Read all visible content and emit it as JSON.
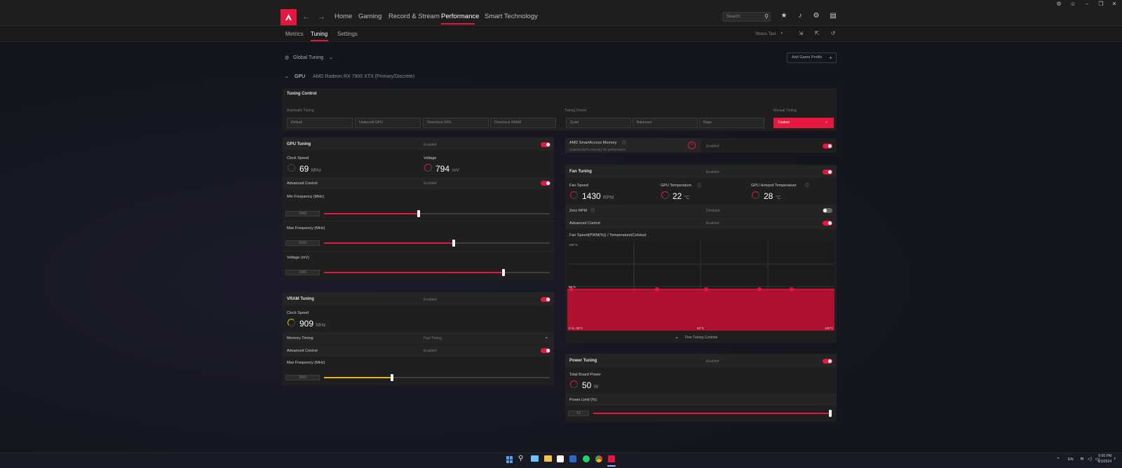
{
  "window": {
    "controls": [
      "⚙",
      "☺",
      "–",
      "❐",
      "✕"
    ]
  },
  "nav": {
    "items": [
      "Home",
      "Gaming",
      "Record & Stream",
      "Performance",
      "Smart Technology"
    ],
    "search_placeholder": "Search"
  },
  "subnav": {
    "items": [
      "Metrics",
      "Tuning",
      "Settings"
    ],
    "stress_test": "Stress Test"
  },
  "profile": {
    "label": "Global Tuning",
    "add_game_profile": "Add Game Profile"
  },
  "gpu": {
    "label": "GPU",
    "name": "AMD Radeon RX 7900 XTX (Primary/Discrete)"
  },
  "tuning_control": {
    "title": "Tuning Control",
    "automatic_label": "Automatic Tuning",
    "automatic": [
      "Default",
      "Undervolt GPU",
      "Overclock GPU",
      "Overclock VRAM"
    ],
    "preset_label": "Tuning Preset",
    "presets": [
      "Quiet",
      "Balanced",
      "Rage"
    ],
    "manual_label": "Manual Tuning",
    "manual": "Custom"
  },
  "gpu_tuning": {
    "title": "GPU Tuning",
    "status": "Enabled",
    "clock_label": "Clock Speed",
    "clock_value": "69",
    "clock_unit": "MHz",
    "voltage_label": "Voltage",
    "voltage_value": "794",
    "voltage_unit": "mV",
    "adv_label": "Advanced Control",
    "adv_status": "Enabled",
    "min_freq_label": "Min Frequency (MHz)",
    "min_freq_value": "2400",
    "min_freq_fill": 0.42,
    "max_freq_label": "Max Frequency (MHz)",
    "max_freq_value": "3100",
    "max_freq_fill": 0.575,
    "volt_label": "Voltage (mV)",
    "volt_value": "1060",
    "volt_fill": 0.795
  },
  "vram_tuning": {
    "title": "VRAM Tuning",
    "status": "Enabled",
    "clock_label": "Clock Speed",
    "clock_value": "909",
    "clock_unit": "MHz",
    "mem_timing_label": "Memory Timing",
    "mem_timing_value": "Fast Timing",
    "adv_label": "Advanced Control",
    "adv_status": "Enabled",
    "max_freq_label": "Max Frequency (MHz)",
    "max_freq_value": "2600",
    "max_freq_fill": 0.3
  },
  "sam": {
    "title": "AMD SmartAccess Memory",
    "desc": "Unlocks dGPU memory for performance",
    "status": "Enabled"
  },
  "fan_tuning": {
    "title": "Fan Tuning",
    "status": "Enabled",
    "fan_speed_label": "Fan Speed",
    "fan_speed_value": "1430",
    "fan_speed_unit": "RPM",
    "gpu_temp_label": "GPU Temperature",
    "gpu_temp_value": "22",
    "gpu_temp_unit": "°C",
    "hotspot_label": "GPU Hotspot Temperature",
    "hotspot_value": "28",
    "hotspot_unit": "°C",
    "zero_rpm_label": "Zero RPM",
    "zero_rpm_status": "Disabled",
    "adv_label": "Advanced Control",
    "adv_status": "Enabled",
    "curve_label": "Fan Speed(PWM(%)) / Temperature(Celsius)",
    "fine_tuning": "Fine Tuning Controls"
  },
  "fan_chart": {
    "y_top": "100 %",
    "y_mid": "50 %",
    "x_start": "0 %, 25°C",
    "x_mid": "62°C",
    "x_end": "100°C"
  },
  "power_tuning": {
    "title": "Power Tuning",
    "status": "Enabled",
    "tbp_label": "Total Board Power",
    "tbp_value": "50",
    "tbp_unit": "W",
    "limit_label": "Power Limit (%)",
    "limit_value": "15",
    "limit_fill": 0.99
  },
  "taskbar": {
    "time": "5:06 PM",
    "date": "8/3/2024",
    "lang": "EN"
  },
  "colors": {
    "accent": "#e5173f",
    "vram": "#f0b400"
  }
}
